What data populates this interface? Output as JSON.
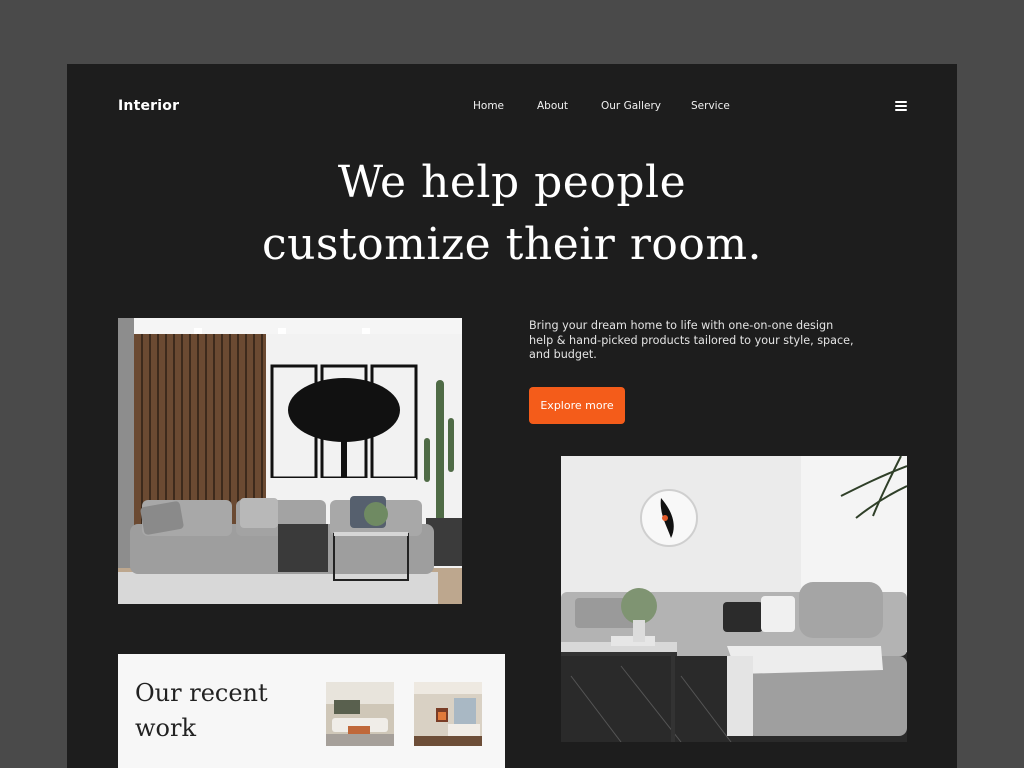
{
  "brand": {
    "logo": "Interior"
  },
  "nav": {
    "items": [
      "Home",
      "About",
      "Our Gallery",
      "Service"
    ]
  },
  "hero": {
    "headline_line1": "We help people",
    "headline_line2": "customize their room.",
    "description": "Bring your dream home to life with one-on-one design help & hand-picked products tailored to your style, space, and budget.",
    "cta_label": "Explore more"
  },
  "recent": {
    "title": "Our recent work"
  },
  "colors": {
    "accent": "#f45c1a",
    "page_bg": "#4a4a4a",
    "frame_bg": "#1d1d1d",
    "card_bg": "#f7f7f7"
  },
  "icons": {
    "menu": "hamburger-menu-icon"
  }
}
